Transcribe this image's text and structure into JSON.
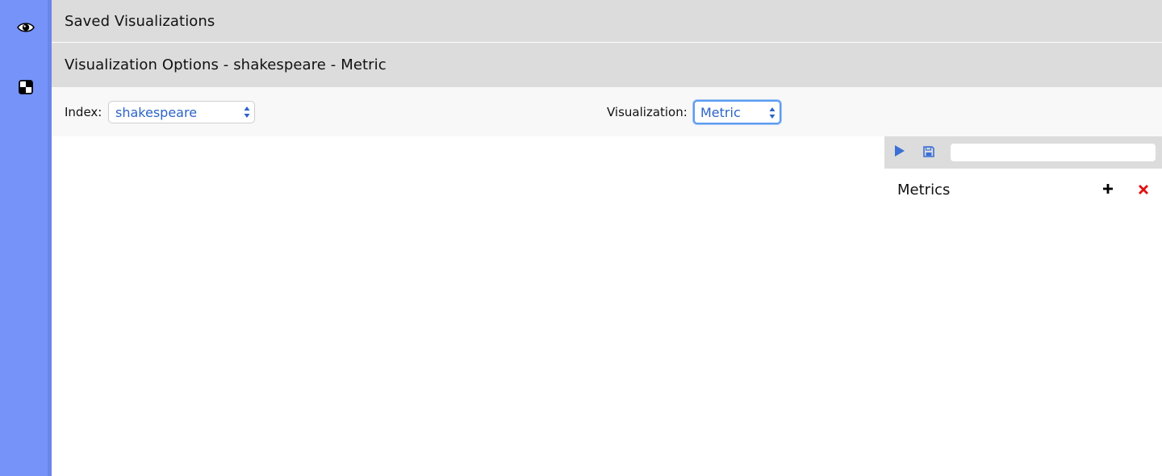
{
  "rail": {
    "items": [
      {
        "icon": "eye-icon"
      },
      {
        "icon": "dashboard-icon"
      }
    ]
  },
  "header": {
    "saved_title": "Saved Visualizations",
    "options_title": "Visualization Options - shakespeare - Metric"
  },
  "options": {
    "index_label": "Index:",
    "index_value": "shakespeare",
    "visualization_label": "Visualization:",
    "visualization_value": "Metric"
  },
  "panel": {
    "run_icon": "play-icon",
    "save_icon": "save-icon",
    "search_value": "",
    "metrics_title": "Metrics",
    "add_icon": "plus-icon",
    "remove_icon": "close-icon"
  },
  "colors": {
    "rail": "#7593f8",
    "header_bar": "#dcdcdc",
    "options_bg": "#f8f8f8",
    "select_text": "#2a64c8",
    "accent_blue": "#3b6fd6",
    "remove_red": "#e01010"
  }
}
